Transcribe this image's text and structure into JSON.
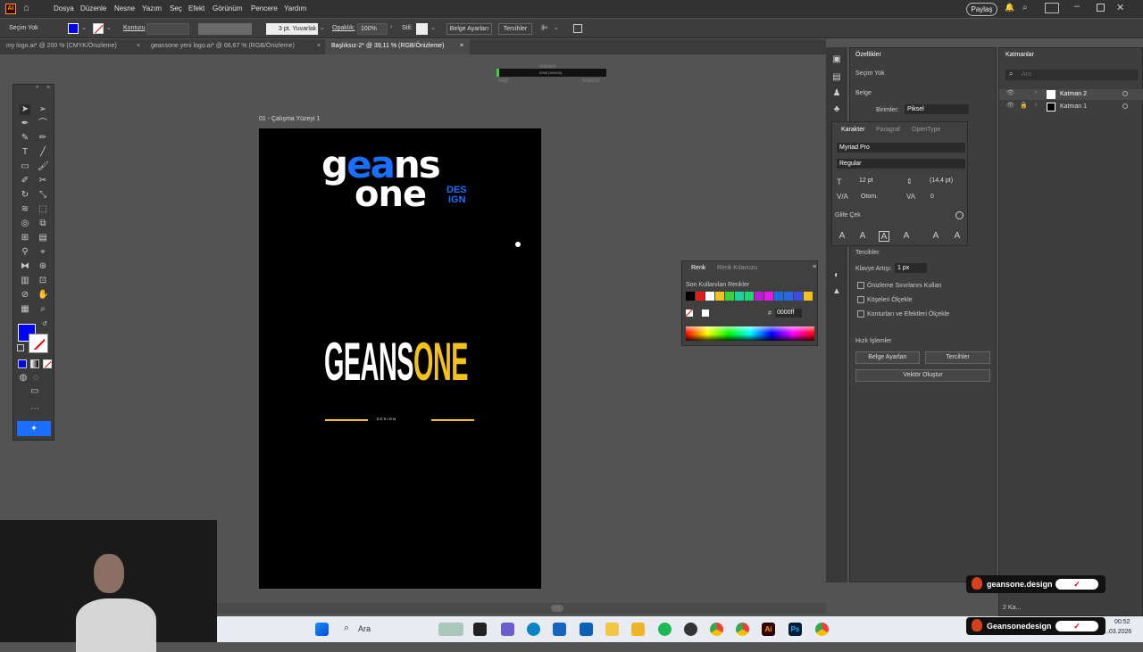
{
  "menubar": {
    "items": [
      "Dosya",
      "Düzenle",
      "Nesne",
      "Yazım",
      "Seç",
      "Efekt",
      "Görünüm",
      "Pencere",
      "Yardım"
    ],
    "share_label": "Paylaş"
  },
  "control_bar": {
    "selection": "Seçim Yok",
    "stroke_label": "Konturu",
    "stroke_profile": "3 pt. Yuvarlak",
    "opacity_label": "Opaklık:",
    "opacity_value": "100%",
    "style_label": "Stil:",
    "doc_setup_label": "Belge Ayarları",
    "prefs_label": "Tercihler"
  },
  "tabs": [
    {
      "label": "my logo.ai* @ 200 % (CMYK/Önizleme)",
      "active": false
    },
    {
      "label": "geansone yeni logo.ai* @ 66,67 % (RGB/Önizleme)",
      "active": false
    },
    {
      "label": "Başlıksız-2* @ 39,11 % (RGB/Önizleme)",
      "active": true
    }
  ],
  "artboard": {
    "label": "01 - Çalışma Yüzeyi 1",
    "logo1": {
      "line1_white_a": "g",
      "line1_blue": "ea",
      "line1_white_b": "ns",
      "line2": "one",
      "design_top": "DES",
      "design_bottom": "IGN"
    },
    "logo2": {
      "white": "GEANS",
      "gold": "ONE",
      "tagline": "D E S I G N"
    }
  },
  "progress_hud": {
    "top": "Vektörel",
    "mid": "0008 (%0000)",
    "left": "%0|0",
    "right": "%1|0000"
  },
  "properties_panel": {
    "title": "Özellikler",
    "no_selection": "Seçim Yok",
    "document": "Belge",
    "units_label": "Birimler:",
    "units_value": "Piksel",
    "prefs_section": "Tercihler",
    "keyboard_inc_label": "Klavye Artışı:",
    "keyboard_inc_value": "1 px",
    "checkbox1": "Önizleme Sınırlarını Kullan",
    "checkbox2": "Köşeleri Ölçekle",
    "checkbox3": "Konturları ve Efektleri Ölçekle",
    "quick_actions": "Hızlı İşlemler",
    "btn_doc_setup": "Belge Ayarları",
    "btn_prefs": "Tercihler",
    "btn_vector": "Vektör Oluştur"
  },
  "character_panel": {
    "tabs": [
      "Karakter",
      "Paragraf",
      "OpenType"
    ],
    "font": "Myriad Pro",
    "style": "Regular",
    "size": "12 pt",
    "leading": "(14,4 pt)",
    "kerning": "Otom.",
    "tracking": "0",
    "glyph_label": "Glife Çek"
  },
  "color_panel": {
    "tabs": [
      "Renk",
      "Renk Kılavuzu"
    ],
    "recent_label": "Son Kullanılan Renkler",
    "hex": "0000ff",
    "recent_colors": [
      "#000000",
      "#e31b1b",
      "#ffffff",
      "#f2c11b",
      "#3ad13a",
      "#19d6a0",
      "#1fd66c",
      "#b91bd9",
      "#e41be0",
      "#1b6fe4",
      "#2b65e0",
      "#3b4de0",
      "#f2c11b"
    ]
  },
  "layers_panel": {
    "title": "Katmanlar",
    "search_placeholder": "Ara",
    "layers": [
      "Katman 2",
      "Katman 1"
    ],
    "count": "2 Ka..."
  },
  "overlays": {
    "badge_top": "geansone.design",
    "badge_bottom": "Geansonedesign"
  },
  "taskbar": {
    "search_placeholder": "Ara",
    "time": "00:52",
    "date": "...03.2026"
  },
  "colors": {
    "accent_blue": "#1a6fff",
    "gold": "#f2c11b",
    "fill_blue": "#0000ff",
    "artboard_bg": "#000000"
  }
}
